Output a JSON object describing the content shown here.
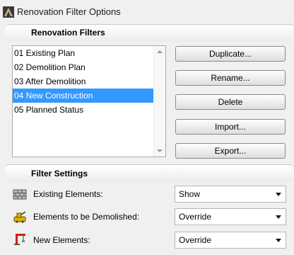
{
  "window": {
    "title": "Renovation Filter Options"
  },
  "filters_section": {
    "title": "Renovation Filters"
  },
  "filters": [
    {
      "label": "01 Existing Plan"
    },
    {
      "label": "02 Demolition Plan"
    },
    {
      "label": "03 After Demolition"
    },
    {
      "label": "04 New Construction"
    },
    {
      "label": "05 Planned Status"
    }
  ],
  "selected_filter": "04 New Construction",
  "buttons": {
    "duplicate": "Duplicate...",
    "rename": "Rename...",
    "delete": "Delete",
    "import": "Import...",
    "export": "Export..."
  },
  "settings_section": {
    "title": "Filter Settings"
  },
  "settings": [
    {
      "label": "Existing Elements:",
      "value": "Show",
      "icon": "existing-elements-icon"
    },
    {
      "label": "Elements to be Demolished:",
      "value": "Override",
      "icon": "demolished-elements-icon"
    },
    {
      "label": "New Elements:",
      "value": "Override",
      "icon": "new-elements-icon"
    }
  ],
  "colors": {
    "selection": "#3399ff",
    "demolish_icon": "#e0b000",
    "new_icon": "#cc2200"
  }
}
